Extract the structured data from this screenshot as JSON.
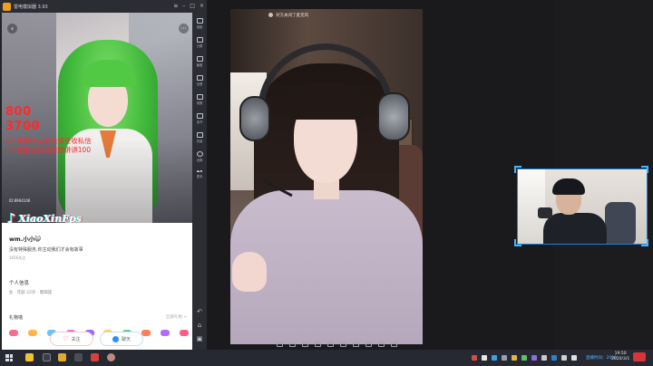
{
  "emulator": {
    "title": "雷电模拟器 3.93",
    "window_buttons": [
      "≡",
      "–",
      "□",
      "×"
    ],
    "toolbar": [
      {
        "label": "键盘",
        "icon": "keyboard-icon"
      },
      {
        "label": "分屏",
        "icon": "split-icon"
      },
      {
        "label": "截图",
        "icon": "screenshot-icon"
      },
      {
        "label": "全屏",
        "icon": "fullscreen-icon"
      },
      {
        "label": "录屏",
        "icon": "record-icon"
      },
      {
        "label": "多开",
        "icon": "multi-icon"
      },
      {
        "label": "安装",
        "icon": "install-icon"
      },
      {
        "label": "设置",
        "icon": "settings-icon"
      },
      {
        "label": "更多",
        "icon": "more-icon"
      }
    ],
    "nav_icons": [
      "back-icon",
      "home-icon",
      "recent-apps-icon"
    ]
  },
  "phone": {
    "overlay_numbers": [
      "800",
      "3700"
    ],
    "overlay_lines": [
      "1个哥哥什么私信请查收私信",
      "1个姐姐说有钱给她讲讲100"
    ],
    "watermark": "XiaoXinFps",
    "watermark_small": "ID:8964106",
    "profile": {
      "name": "wm.小小😺",
      "bio": "没有特殊服务,你主动我们才会有故事",
      "id_line": "1656关注",
      "section_title": "个人信息",
      "info": "女 · 年龄 22岁 · 摩羯座",
      "gifts_title": "礼物墙",
      "gifts_more": "全部礼物 >",
      "gift_colors": [
        "#ff6b8a",
        "#ffb547",
        "#6bc1ff",
        "#ff6bd0",
        "#9b6bff",
        "#ffd54a",
        "#5fd38a",
        "#ff7f50",
        "#b36bff",
        "#ff5c8a"
      ]
    },
    "actions": {
      "follow_label": "关注",
      "chat_label": "聊天"
    }
  },
  "stage": {
    "video_title": "对方关闭了麦克风",
    "controls": [
      "screen-icon",
      "camera-icon",
      "mic-icon",
      "video-icon",
      "gift-icon",
      "image-icon",
      "grid-icon",
      "pen-icon",
      "settings-icon",
      "more-icon"
    ]
  },
  "webcam": {
    "label": "streamer webcam"
  },
  "taskbar": {
    "apps": [
      "search-app",
      "folder-app",
      "app-yellow",
      "app-red",
      "app-blue",
      "app-avatar"
    ],
    "tray_text": "直播时间：2000",
    "clock_time": "19:50",
    "clock_date": "2020/3/1"
  },
  "colors": {
    "overlay_red": "#ff2a2a",
    "accent_blue": "#1e7fd8",
    "taskbar_bg": "#262932"
  }
}
